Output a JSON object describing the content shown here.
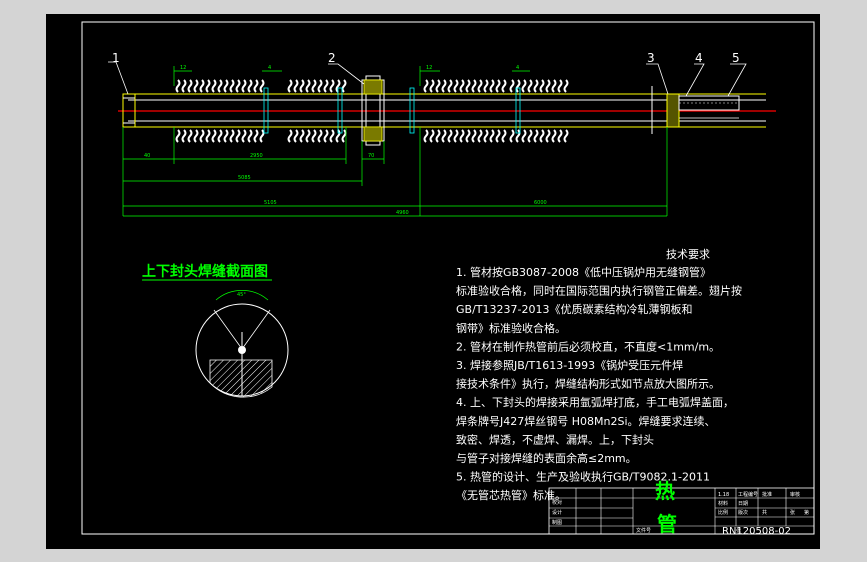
{
  "callouts": [
    "1",
    "2",
    "3",
    "4",
    "5"
  ],
  "dimensions": {
    "top_small": [
      "12",
      "4",
      "12",
      "4"
    ],
    "d40": "40",
    "d70": "70",
    "d2950": "2950",
    "d5085": "5085",
    "d5105": "5105",
    "d6000": "6000",
    "d4960": "4960"
  },
  "weld_section": {
    "title": "上下封头焊缝截面图",
    "angle_label": "45°"
  },
  "tech": {
    "title": "技术要求",
    "lines": [
      "1. 管材按GB3087-2008《低中压锅炉用无缝钢管》",
      "标准验收合格，同时在国际范围内执行钢管正偏差。翅片按",
      "GB/T13237-2013《优质碳素结构冷轧薄钢板和",
      "钢带》标准验收合格。",
      "2. 管材在制作热管前后必须校直，不直度<1mm/m。",
      "3. 焊接参照JB/T1613-1993《锅炉受压元件焊",
      "接技术条件》执行，焊缝结构形式如节点放大图所示。",
      "4. 上、下封头的焊接采用氩弧焊打底，手工电弧焊盖面，",
      "焊条牌号J427焊丝钢号 H08Mn2Si。焊缝要求连续、",
      "致密、焊透，不虚焊、漏焊。上，下封头",
      "与管子对接焊缝的表面余高≤2mm。",
      "5. 热管的设计、生产及验收执行GB/T9082.1-2011",
      "《无管芯热管》标准。"
    ]
  },
  "title_block": {
    "name_char1": "热",
    "name_char2": "管",
    "drawing_no": "RN120508-02",
    "small_labels": [
      "1.18",
      "工程编号",
      "批准",
      "审核",
      "校对",
      "设计",
      "制图",
      "材料",
      "比例",
      "日期",
      "版次",
      "共",
      "张",
      "第",
      "张",
      "文件号"
    ]
  },
  "colors": {
    "background": "#000000",
    "outline": "#ffffff",
    "dimension": "#00ff00",
    "tube": "#ffff00",
    "centerline": "#ff0000",
    "cyan": "#00ffff",
    "blue": "#0000ff"
  }
}
